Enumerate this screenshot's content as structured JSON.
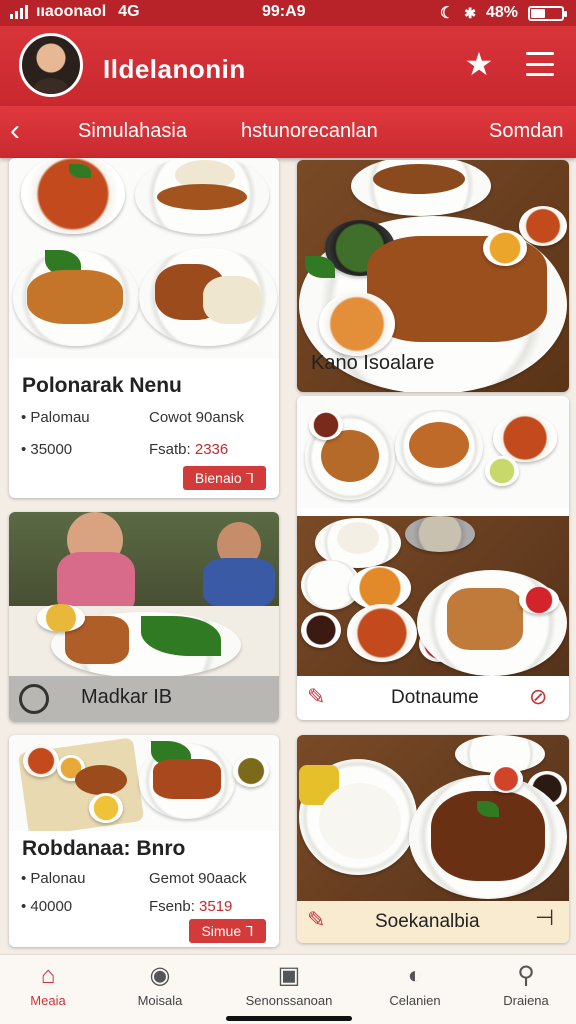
{
  "status_bar": {
    "carrier": "ııaoonaol",
    "network": "4G",
    "time": "99:A9",
    "battery": "48%",
    "battery_level": 0.48,
    "icons": [
      "signal-bars-icon",
      "moon-icon",
      "bluetooth-icon",
      "battery-icon"
    ]
  },
  "header": {
    "title": "Ildelanonin",
    "icons": [
      "avatar",
      "star-icon",
      "hamburger-menu-icon"
    ]
  },
  "tabs": {
    "items": [
      "Simulahasia",
      "hstunorecanlan",
      "Somdan"
    ],
    "back_icon": "chevron-left-icon"
  },
  "cards": {
    "card1": {
      "title": "Polonarak Nenu",
      "meta_left": "Palomau",
      "meta_right": "Cowot 90ansk",
      "price_left": "35000",
      "price_right_label": "Fsatb:",
      "price_right_value": "2336",
      "button": "Bienaio ᒣ"
    },
    "card2": {
      "overlay_label": "Kano Isoalare"
    },
    "card3": {
      "band_label": "Dotnaume"
    },
    "card4": {
      "band_label": "Madkar IB"
    },
    "card5": {
      "title": "Robdanaa: Bnro",
      "meta_left": "Palonau",
      "meta_right": "Gemot 90aack",
      "price_left": "40000",
      "price_right_label": "Fsenb:",
      "price_right_value": "3519",
      "button": "Simue ᒣ"
    },
    "card6": {
      "band_label": "Soekanalbia"
    }
  },
  "bottom_nav": {
    "items": [
      {
        "label": "Meaia",
        "icon": "home-icon",
        "active": true
      },
      {
        "label": "Moisala",
        "icon": "bag-icon",
        "active": false
      },
      {
        "label": "Senonssanoan",
        "icon": "storefront-icon",
        "active": false
      },
      {
        "label": "Celanien",
        "icon": "bowl-icon",
        "active": false
      },
      {
        "label": "Draiena",
        "icon": "search-icon",
        "active": false
      }
    ]
  },
  "colors": {
    "brand_red": "#c9282f",
    "background": "#f3ede6",
    "accent_red": "#d33a3a"
  }
}
